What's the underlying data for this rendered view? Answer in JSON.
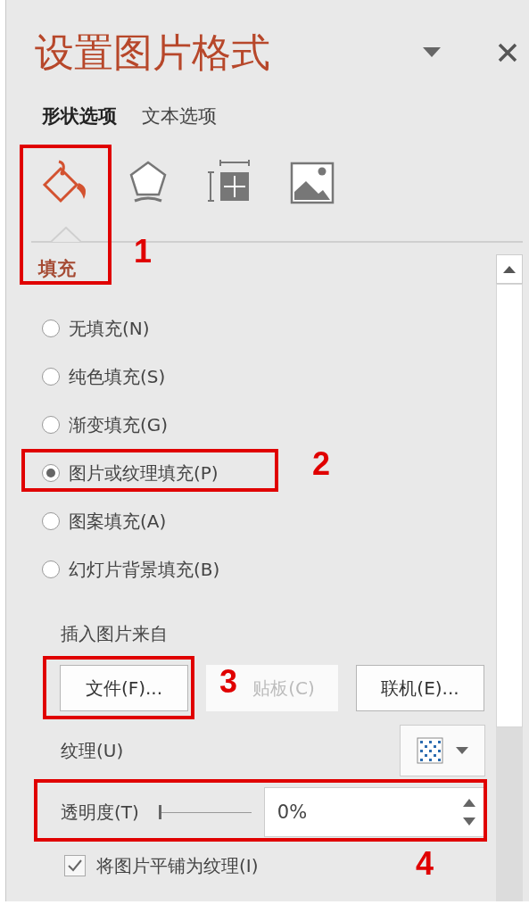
{
  "panel": {
    "title": "设置图片格式"
  },
  "tabs": [
    {
      "label": "形状选项",
      "selected": true
    },
    {
      "label": "文本选项",
      "selected": false
    }
  ],
  "icon_tabs": [
    {
      "kind": "fill",
      "selected": true
    },
    {
      "kind": "effects",
      "selected": false
    },
    {
      "kind": "size",
      "selected": false
    },
    {
      "kind": "picture",
      "selected": false
    }
  ],
  "section": {
    "title": "填充"
  },
  "fill_options": [
    {
      "label": "无填充(N)",
      "selected": false
    },
    {
      "label": "纯色填充(S)",
      "selected": false
    },
    {
      "label": "渐变填充(G)",
      "selected": false
    },
    {
      "label": "图片或纹理填充(P)",
      "selected": true
    },
    {
      "label": "图案填充(A)",
      "selected": false
    },
    {
      "label": "幻灯片背景填充(B)",
      "selected": false
    }
  ],
  "insert": {
    "label": "插入图片来自",
    "buttons": [
      {
        "label": "文件(F)...",
        "disabled": false
      },
      {
        "label": "贴板(C)",
        "disabled": true
      },
      {
        "label": "联机(E)...",
        "disabled": false
      }
    ]
  },
  "texture": {
    "label": "纹理(U)"
  },
  "transparency": {
    "label": "透明度(T)",
    "level": 0,
    "value": "0%"
  },
  "tile": {
    "label": "将图片平铺为纹理(I)",
    "checked": true
  },
  "annotations": [
    {
      "number": "1"
    },
    {
      "number": "2"
    },
    {
      "number": "3"
    },
    {
      "number": "4"
    }
  ]
}
